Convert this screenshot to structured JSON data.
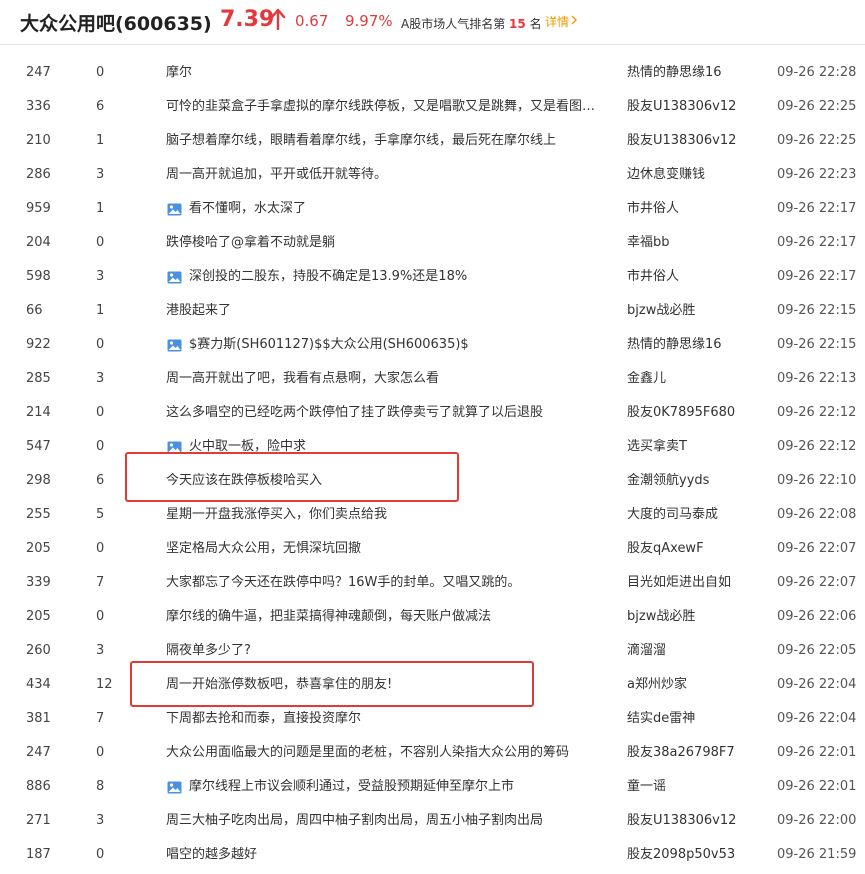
{
  "header": {
    "stock_name": "大众公用吧(600635)",
    "price": "7.39",
    "change": "0.67",
    "change_pct": "9.97%",
    "rank_prefix": "A股市场人气排名第",
    "rank_num": "15",
    "rank_suffix": "名",
    "detail_label": "详情",
    "up_color": "#e4393c",
    "detail_color": "#f39800"
  },
  "posts": [
    {
      "read": "247",
      "reply": "0",
      "title": "摩尔",
      "author": "热情的静思缘16",
      "time": "09-26 22:28",
      "has_image": false
    },
    {
      "read": "336",
      "reply": "6",
      "title": "可怜的韭菜盒子手拿虚拟的摩尔线跌停板，又是唱歌又是跳舞，又是看图又是看线",
      "author": "股友U138306v12",
      "time": "09-26 22:25",
      "has_image": false
    },
    {
      "read": "210",
      "reply": "1",
      "title": "脑子想着摩尔线，眼睛看着摩尔线，手拿摩尔线，最后死在摩尔线上",
      "author": "股友U138306v12",
      "time": "09-26 22:25",
      "has_image": false
    },
    {
      "read": "286",
      "reply": "3",
      "title": "周一高开就追加，平开或低开就等待。",
      "author": "边休息变赚钱",
      "time": "09-26 22:23",
      "has_image": false
    },
    {
      "read": "959",
      "reply": "1",
      "title": "看不懂啊，水太深了",
      "author": "市井俗人",
      "time": "09-26 22:17",
      "has_image": true
    },
    {
      "read": "204",
      "reply": "0",
      "title": "跌停梭哈了@拿着不动就是躺",
      "author": "幸福bb",
      "time": "09-26 22:17",
      "has_image": false
    },
    {
      "read": "598",
      "reply": "3",
      "title": "深创投的二股东，持股不确定是13.9%还是18%",
      "author": "市井俗人",
      "time": "09-26 22:17",
      "has_image": true
    },
    {
      "read": "66",
      "reply": "1",
      "title": "港股起来了",
      "author": "bjzw战必胜",
      "time": "09-26 22:15",
      "has_image": false
    },
    {
      "read": "922",
      "reply": "0",
      "title": "$赛力斯(SH601127)$$大众公用(SH600635)$",
      "author": "热情的静思缘16",
      "time": "09-26 22:15",
      "has_image": true
    },
    {
      "read": "285",
      "reply": "3",
      "title": "周一高开就出了吧，我看有点悬啊，大家怎么看",
      "author": "金鑫儿",
      "time": "09-26 22:13",
      "has_image": false
    },
    {
      "read": "214",
      "reply": "0",
      "title": "这么多唱空的已经吃两个跌停怕了挂了跌停卖亏了就算了以后退股",
      "author": "股友0K7895F680",
      "time": "09-26 22:12",
      "has_image": false
    },
    {
      "read": "547",
      "reply": "0",
      "title": "火中取一板，险中求",
      "author": "选买拿卖T",
      "time": "09-26 22:12",
      "has_image": true
    },
    {
      "read": "298",
      "reply": "6",
      "title": "今天应该在跌停板梭哈买入",
      "author": "金潮领航yyds",
      "time": "09-26 22:10",
      "has_image": false
    },
    {
      "read": "255",
      "reply": "5",
      "title": "星期一开盘我涨停买入，你们卖点给我",
      "author": "大度的司马泰成",
      "time": "09-26 22:08",
      "has_image": false
    },
    {
      "read": "205",
      "reply": "0",
      "title": "坚定格局大众公用，无惧深坑回撤",
      "author": "股友qAxewF",
      "time": "09-26 22:07",
      "has_image": false
    },
    {
      "read": "339",
      "reply": "7",
      "title": "大家都忘了今天还在跌停中吗？16W手的封单。又唱又跳的。",
      "author": "目光如炬进出自如",
      "time": "09-26 22:07",
      "has_image": false
    },
    {
      "read": "205",
      "reply": "0",
      "title": "摩尔线的确牛逼，把韭菜搞得神魂颠倒，每天账户做减法",
      "author": "bjzw战必胜",
      "time": "09-26 22:06",
      "has_image": false
    },
    {
      "read": "260",
      "reply": "3",
      "title": "隔夜单多少了?",
      "author": "滴溜溜",
      "time": "09-26 22:05",
      "has_image": false
    },
    {
      "read": "434",
      "reply": "12",
      "title": "周一开始涨停数板吧，恭喜拿住的朋友!",
      "author": "a郑州炒家",
      "time": "09-26 22:04",
      "has_image": false
    },
    {
      "read": "381",
      "reply": "7",
      "title": "下周都去抢和而泰，直接投资摩尔",
      "author": "结实de雷神",
      "time": "09-26 22:04",
      "has_image": false
    },
    {
      "read": "247",
      "reply": "0",
      "title": "大众公用面临最大的问题是里面的老桩，不容别人染指大众公用的筹码",
      "author": "股友38a26798F7",
      "time": "09-26 22:01",
      "has_image": false
    },
    {
      "read": "886",
      "reply": "8",
      "title": "摩尔线程上市议会顺利通过，受益股预期延伸至摩尔上市",
      "author": "童一谣",
      "time": "09-26 22:01",
      "has_image": true
    },
    {
      "read": "271",
      "reply": "3",
      "title": "周三大柚子吃肉出局，周四中柚子割肉出局，周五小柚子割肉出局",
      "author": "股友U138306v12",
      "time": "09-26 22:00",
      "has_image": false
    },
    {
      "read": "187",
      "reply": "0",
      "title": "唱空的越多越好",
      "author": "股友2098p50v53",
      "time": "09-26 21:59",
      "has_image": false
    }
  ],
  "highlight_color": "#e53935"
}
